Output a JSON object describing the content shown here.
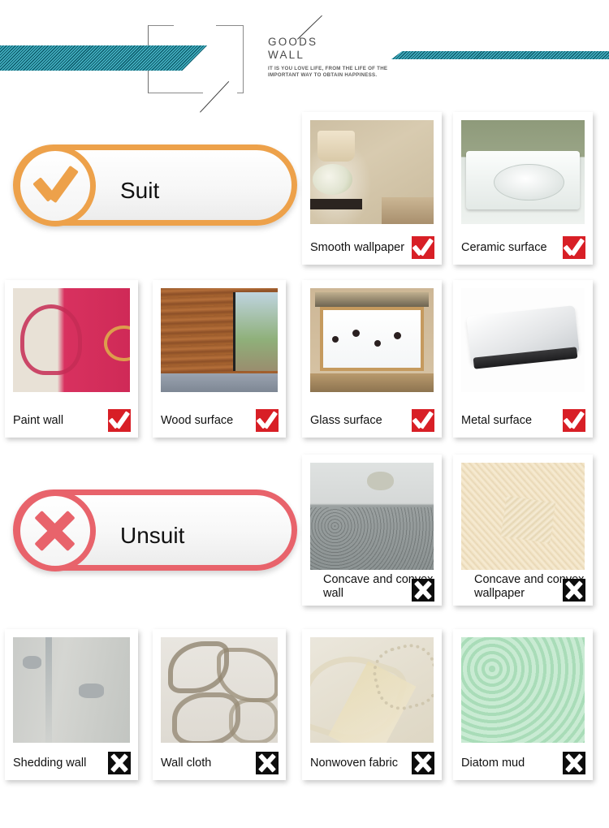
{
  "header": {
    "title_line1": "GOODS",
    "title_line2": "WALL",
    "subtitle": "IT IS YOU LOVE LIFE, FROM THE LIFE OF THE IMPORTANT WAY TO OBTAIN HAPPINESS.",
    "accent_teal": "#1a7f93"
  },
  "banners": {
    "suit": {
      "label": "Suit",
      "color": "#eda14a",
      "icon": "check-icon"
    },
    "unsuit": {
      "label": "Unsuit",
      "color": "#e8636b",
      "icon": "cross-icon"
    }
  },
  "marks": {
    "ok": {
      "icon": "check-mark-icon",
      "bg": "#d81f26"
    },
    "no": {
      "icon": "x-mark-icon",
      "bg": "#0d0d0d"
    }
  },
  "suit_cards": [
    {
      "label": "Smooth wallpaper",
      "mark": "ok"
    },
    {
      "label": "Ceramic surface",
      "mark": "ok"
    },
    {
      "label": "Paint wall",
      "mark": "ok"
    },
    {
      "label": "Wood surface",
      "mark": "ok"
    },
    {
      "label": "Glass surface",
      "mark": "ok"
    },
    {
      "label": "Metal surface",
      "mark": "ok"
    }
  ],
  "unsuit_cards": [
    {
      "label": "Concave and convex wall",
      "mark": "no"
    },
    {
      "label": "Concave and convex wallpaper",
      "mark": "no"
    },
    {
      "label": "Shedding wall",
      "mark": "no"
    },
    {
      "label": "Wall cloth",
      "mark": "no"
    },
    {
      "label": "Nonwoven fabric",
      "mark": "no"
    },
    {
      "label": "Diatom mud",
      "mark": "no"
    }
  ]
}
